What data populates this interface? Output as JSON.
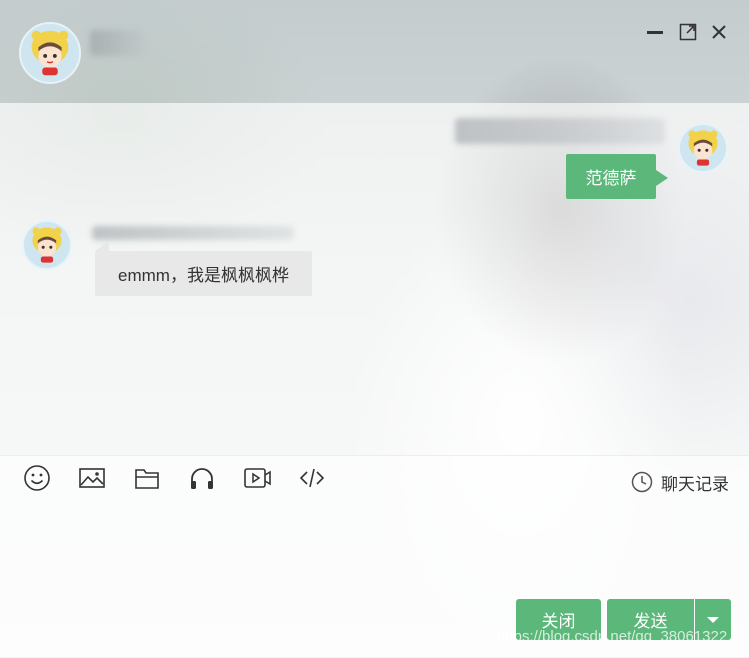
{
  "messages": {
    "sent_text": "范德萨",
    "received_text": "emmm，我是枫枫枫桦"
  },
  "toolbar": {
    "tools": [
      "emoji-icon",
      "image-icon",
      "folder-icon",
      "headphones-icon",
      "video-icon",
      "code-icon"
    ],
    "history_label": "聊天记录"
  },
  "footer": {
    "close_label": "关闭",
    "send_label": "发送"
  },
  "watermark": "https://blog.csdn.net/qq_38061322",
  "colors": {
    "accent": "#5cb77a",
    "received_bubble": "#e8e8e8"
  }
}
